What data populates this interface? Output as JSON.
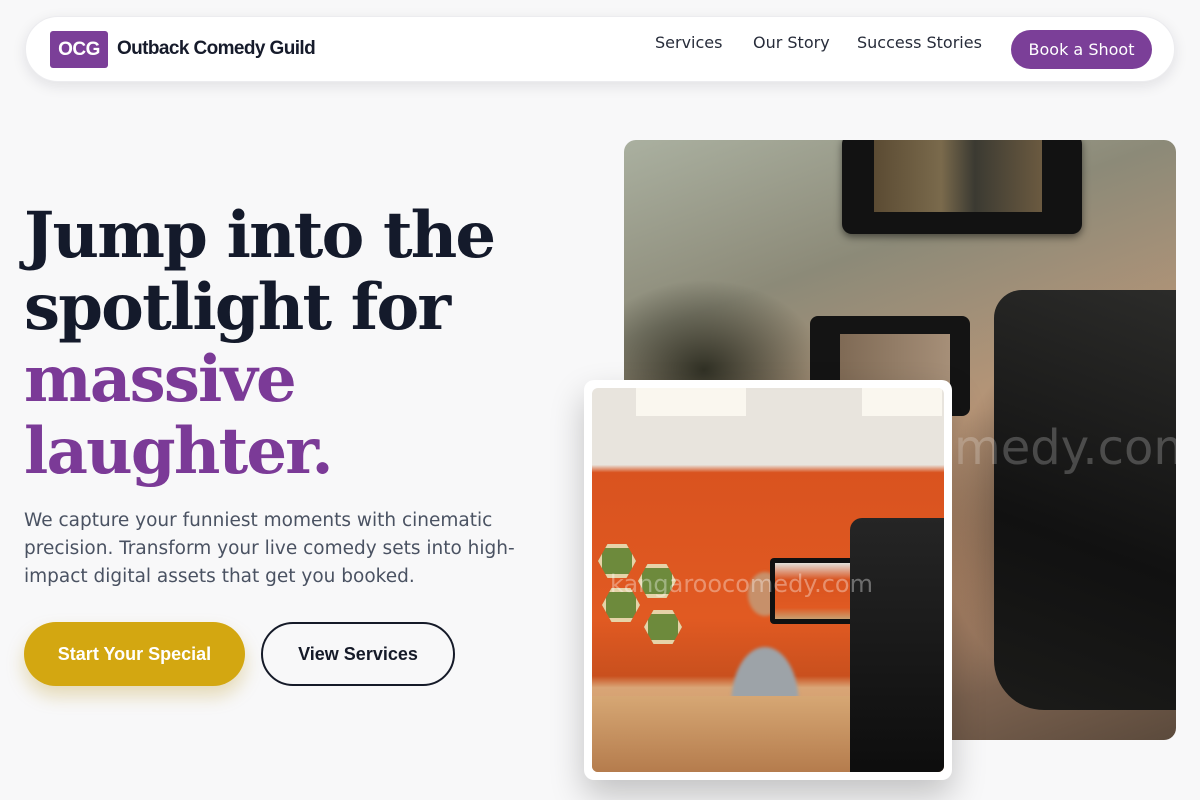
{
  "header": {
    "logo_badge": "OCG",
    "brand_name": "Outback Comedy Guild",
    "nav": {
      "services": "Services",
      "our_story": "Our Story",
      "success_stories": "Success Stories"
    },
    "cta": "Book a Shoot"
  },
  "hero": {
    "headline_line1": "Jump into the",
    "headline_line2": "spotlight for",
    "headline_accent1": "massive",
    "headline_accent2": "laughter.",
    "subcopy": "We capture your funniest moments with cinematic precision. Transform your live comedy sets into high-impact digital assets that get you booked.",
    "primary_button": "Start Your Special",
    "secondary_button": "View Services"
  },
  "images": {
    "main_watermark": "medy.com",
    "inset_watermark": "kangaroocomedy.com"
  },
  "colors": {
    "brand_purple": "#7b3f98",
    "accent_gold": "#d3a711",
    "headline_dark": "#141a2b",
    "background": "#f8f8f9"
  }
}
